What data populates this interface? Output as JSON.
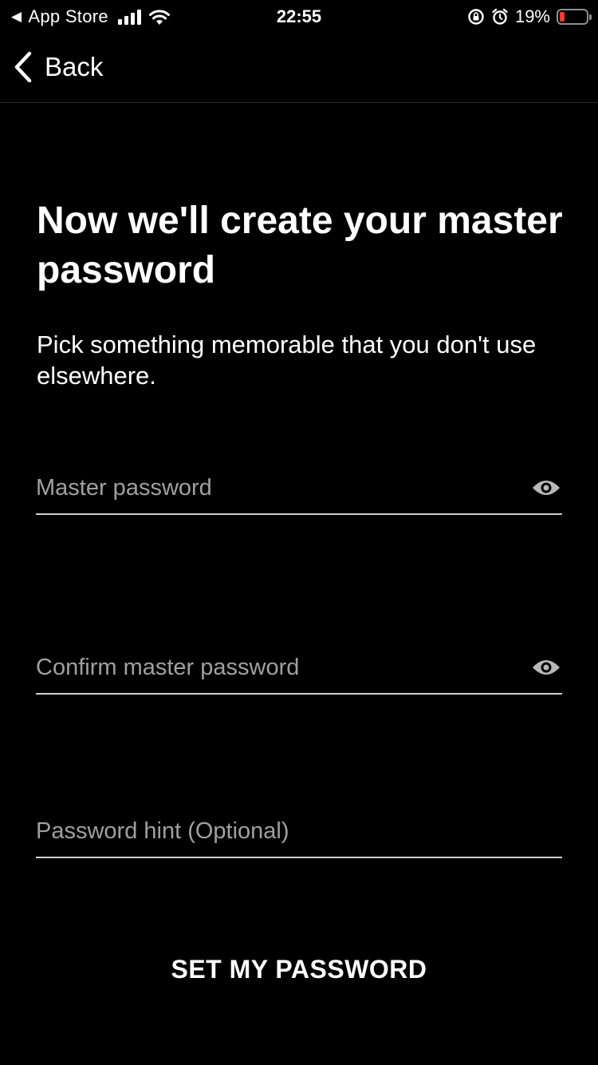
{
  "status_bar": {
    "back_app": "App Store",
    "time": "22:55",
    "battery_text": "19%",
    "battery_level": 0.19,
    "battery_color": "#ff3b30",
    "icons": [
      "back-triangle-icon",
      "signal-icon",
      "wifi-icon",
      "rotation-lock-icon",
      "alarm-icon",
      "battery-icon"
    ]
  },
  "nav": {
    "back_label": "Back",
    "back_icon": "chevron-left-icon"
  },
  "main": {
    "title": "Now we'll create your master password",
    "subtitle": "Pick something memorable that you don't use elsewhere.",
    "fields": [
      {
        "placeholder": "Master password",
        "value": "",
        "icon": "eye-icon"
      },
      {
        "placeholder": "Confirm master password",
        "value": "",
        "icon": "eye-icon"
      },
      {
        "placeholder": "Password hint (Optional)",
        "value": ""
      }
    ],
    "submit_label": "SET MY PASSWORD"
  },
  "colors": {
    "background": "#000000",
    "text": "#ffffff",
    "placeholder": "#a0a0a0",
    "underline": "#cfcfcf",
    "icon": "#b8b8b8"
  }
}
